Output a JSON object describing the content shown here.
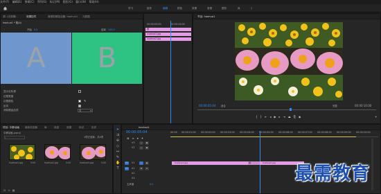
{
  "menu": [
    "文件(F)",
    "编辑(E)",
    "剪辑(C)",
    "序列(S)",
    "标记(M)",
    "图形(G)",
    "窗口(W)",
    "帮助(H)"
  ],
  "workspace_tabs": [
    "学习",
    "组件",
    "编辑",
    "颜色",
    "效果",
    "音频",
    "图形",
    "库",
    "》"
  ],
  "workspace_active": "编辑",
  "effect_controls": {
    "tabs": [
      "源: (无剪辑)",
      "效果控件",
      "音频剪辑混合器: haohua1",
      "元数据"
    ],
    "active_tab": "效果控件",
    "breadcrumb": "haohua1 * 推(A)",
    "label_a": "开始",
    "label_a_value": "0.0",
    "label_b": "结束",
    "label_b_value": "100.0",
    "letter_a": "A",
    "letter_b": "B",
    "properties": [
      "显示实际源",
      "边框宽度",
      "边框颜色",
      "反向",
      "消除锯齿品质"
    ],
    "antialias_value": "关"
  },
  "mini_timeline": {
    "timecodes": [
      "00:00:05:00",
      "00:00:10:00"
    ],
    "clip_label": "推",
    "clip1": "huahua1.jpg",
    "clip2": "huahua2.jpg"
  },
  "program_monitor": {
    "tab": "节目: haohua1",
    "timecode_left": "00:00:05:04",
    "fit": "适合",
    "quality": "完整",
    "timecode_right": "00:00:10:00"
  },
  "project": {
    "tabs": [
      "项目: 平移动画",
      "媒体浏览器",
      "库",
      "信息",
      "效果",
      "标记",
      "历史"
    ],
    "path": "平移动画.prproj",
    "item_count": "1项已选择，共4项",
    "items": [
      {
        "name": "huahua1.jpg",
        "duration": "5:00"
      },
      {
        "name": "huahua2.jpg",
        "duration": "5:00"
      },
      {
        "name": "huahua3.jpg",
        "duration": "5:00"
      }
    ]
  },
  "timeline": {
    "tab": "haohua1",
    "timecode": "00:00:05:04",
    "ruler": [
      "00:00",
      "00:00:01:00",
      "00:00:02:00",
      "00:00:03:00",
      "00:00:04:00",
      "00:00:05:00",
      "00:00:06:00",
      "00:00:07:00",
      "00:00:08:00",
      "00:00:09:00",
      "00:00:10:00"
    ],
    "tracks": [
      "V3",
      "V2",
      "V1",
      "A1",
      "A2",
      "A3",
      "主声道"
    ],
    "master_value": "0.0",
    "clip1": "huahua1.jpg",
    "transition": "推",
    "clip2": "huahua2.jpg"
  },
  "watermark": "最需教育",
  "colors": {
    "accent": "#2e8cf0",
    "clip": "#e39be3",
    "transition_a": "#6f97cd",
    "transition_b": "#2ec383"
  }
}
